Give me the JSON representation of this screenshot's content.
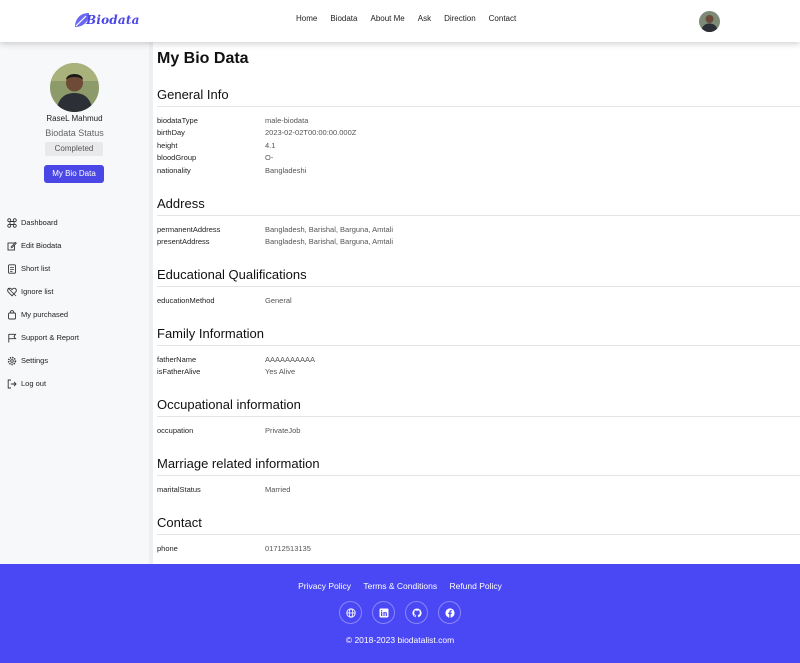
{
  "header": {
    "logo_text": "Biodata",
    "nav": [
      "Home",
      "Biodata",
      "About Me",
      "Ask",
      "Direction",
      "Contact"
    ]
  },
  "sidebar": {
    "name": "RaseL Mahmud",
    "status_label": "Biodata Status",
    "status_value": "Completed",
    "primary_button": "My Bio Data",
    "menu": [
      {
        "label": "Dashboard",
        "icon": "command-icon"
      },
      {
        "label": "Edit Biodata",
        "icon": "edit-icon"
      },
      {
        "label": "Short list",
        "icon": "list-icon"
      },
      {
        "label": "Ignore list",
        "icon": "heart-off-icon"
      },
      {
        "label": "My purchased",
        "icon": "bag-icon"
      },
      {
        "label": "Support & Report",
        "icon": "flag-icon"
      },
      {
        "label": "Settings",
        "icon": "gear-icon"
      },
      {
        "label": "Log out",
        "icon": "logout-icon"
      }
    ]
  },
  "main": {
    "title": "My Bio Data",
    "sections": [
      {
        "title": "General Info",
        "rows": [
          {
            "key": "biodataType",
            "value": "male-biodata"
          },
          {
            "key": "birthDay",
            "value": "2023-02-02T00:00:00.000Z"
          },
          {
            "key": "height",
            "value": "4.1"
          },
          {
            "key": "bloodGroup",
            "value": "O-"
          },
          {
            "key": "nationality",
            "value": "Bangladeshi"
          }
        ]
      },
      {
        "title": "Address",
        "rows": [
          {
            "key": "permanentAddress",
            "value": "Bangladesh, Barishal, Barguna, Amtali"
          },
          {
            "key": "presentAddress",
            "value": "Bangladesh, Barishal, Barguna, Amtali"
          }
        ]
      },
      {
        "title": "Educational Qualifications",
        "rows": [
          {
            "key": "educationMethod",
            "value": "General"
          }
        ]
      },
      {
        "title": "Family Information",
        "rows": [
          {
            "key": "fatherName",
            "value": "AAAAAAAAAA"
          },
          {
            "key": "isFatherAlive",
            "value": "Yes Alive"
          }
        ]
      },
      {
        "title": "Occupational information",
        "rows": [
          {
            "key": "occupation",
            "value": "PrivateJob"
          }
        ]
      },
      {
        "title": "Marriage related information",
        "rows": [
          {
            "key": "maritalStatus",
            "value": "Married"
          }
        ]
      },
      {
        "title": "Contact",
        "rows": [
          {
            "key": "phone",
            "value": "01712513135"
          }
        ]
      }
    ]
  },
  "footer": {
    "links": [
      "Privacy Policy",
      "Terms & Conditions",
      "Refund Policy"
    ],
    "social": [
      "globe-icon",
      "linkedin-icon",
      "github-icon",
      "facebook-icon"
    ],
    "copyright": "© 2018-2023 biodatalist.com"
  },
  "colors": {
    "accent": "#4a47e6",
    "footer": "#4a47f5"
  }
}
